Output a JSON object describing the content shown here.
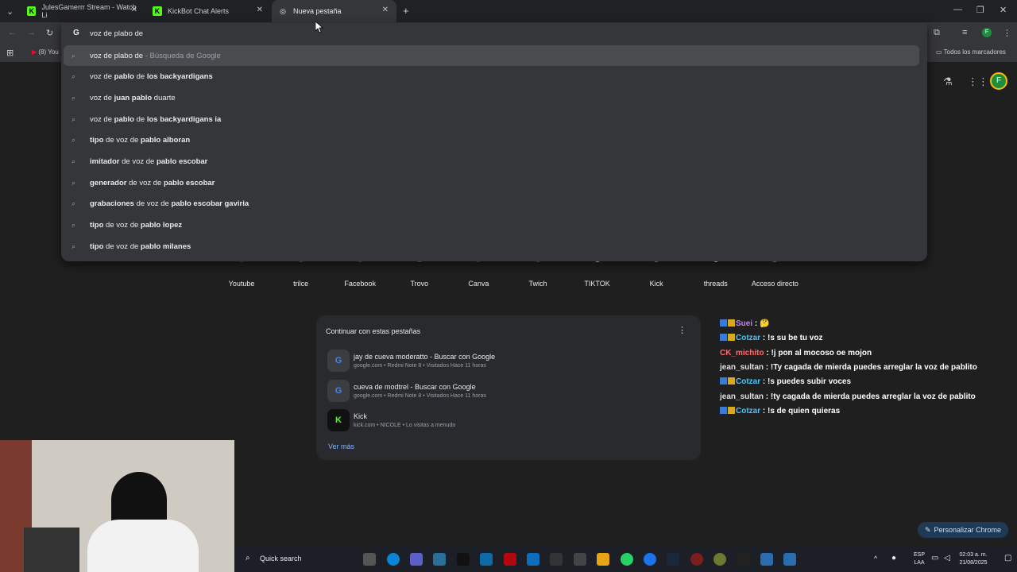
{
  "browser": {
    "tabs": [
      {
        "label": "JulesGamerrr Stream - Watch Li",
        "favicon": "K"
      },
      {
        "label": "KickBot Chat Alerts",
        "favicon": "K"
      },
      {
        "label": "Nueva pestaña",
        "favicon": "◎"
      }
    ],
    "new_tab_symbol": "+",
    "omnibox_value": "voz de plabo de",
    "bookmark_item": "(8) You",
    "all_bookmarks": "Todos los marcadores",
    "profile_letter": "F"
  },
  "suggestions": [
    {
      "icon": "search-icon",
      "parts": [
        {
          "t": "voz de plabo de",
          "b": false
        },
        {
          "t": " - Búsqueda de Google",
          "b": false,
          "desc": true
        }
      ]
    },
    {
      "icon": "search-icon",
      "parts": [
        {
          "t": "voz de ",
          "b": false
        },
        {
          "t": "pablo",
          "b": true
        },
        {
          "t": " de ",
          "b": false
        },
        {
          "t": "los backyardigans",
          "b": true
        }
      ]
    },
    {
      "icon": "search-icon",
      "parts": [
        {
          "t": "voz de ",
          "b": false
        },
        {
          "t": "juan pablo",
          "b": true
        },
        {
          "t": " duarte",
          "b": false
        }
      ]
    },
    {
      "icon": "search-icon",
      "parts": [
        {
          "t": "voz de ",
          "b": false
        },
        {
          "t": "pablo",
          "b": true
        },
        {
          "t": " de ",
          "b": false
        },
        {
          "t": "los backyardigans ia",
          "b": true
        }
      ]
    },
    {
      "icon": "search-icon",
      "parts": [
        {
          "t": "tipo",
          "b": true
        },
        {
          "t": " de voz de ",
          "b": false
        },
        {
          "t": "pablo alboran",
          "b": true
        }
      ]
    },
    {
      "icon": "search-icon",
      "parts": [
        {
          "t": "imitador",
          "b": true
        },
        {
          "t": " de voz de ",
          "b": false
        },
        {
          "t": "pablo escobar",
          "b": true
        }
      ]
    },
    {
      "icon": "search-icon",
      "parts": [
        {
          "t": "generador",
          "b": true
        },
        {
          "t": " de voz de ",
          "b": false
        },
        {
          "t": "pablo escobar",
          "b": true
        }
      ]
    },
    {
      "icon": "search-icon",
      "parts": [
        {
          "t": "grabaciones",
          "b": true
        },
        {
          "t": " de voz de ",
          "b": false
        },
        {
          "t": "pablo escobar gaviria",
          "b": true
        }
      ]
    },
    {
      "icon": "search-icon",
      "parts": [
        {
          "t": "tipo",
          "b": true
        },
        {
          "t": " de voz de ",
          "b": false
        },
        {
          "t": "pablo lopez",
          "b": true
        }
      ]
    },
    {
      "icon": "search-icon",
      "parts": [
        {
          "t": "tipo",
          "b": true
        },
        {
          "t": " de voz de ",
          "b": false
        },
        {
          "t": "pablo milanes",
          "b": true
        }
      ]
    }
  ],
  "shortcuts": [
    {
      "label": "Youtube",
      "color": "#ff0033"
    },
    {
      "label": "trilce",
      "color": "#e53935"
    },
    {
      "label": "Facebook",
      "color": "#1877f2"
    },
    {
      "label": "Trovo",
      "color": "#19d66b"
    },
    {
      "label": "Canva",
      "color": "#7d2ae8"
    },
    {
      "label": "Twich",
      "color": "#9146ff"
    },
    {
      "label": "TIKTOK",
      "color": "#ffffff"
    },
    {
      "label": "Kick",
      "color": "#53fc18"
    },
    {
      "label": "threads",
      "color": "#ffffff"
    },
    {
      "label": "Acceso directo",
      "color": "#8ab4f8"
    }
  ],
  "continue_card": {
    "title": "Continuar con estas pestañas",
    "items": [
      {
        "title": "jay de cueva moderatto - Buscar con Google",
        "meta": "google.com • Redmi Note 8 • Visitados Hace 11 horas",
        "icon": "G"
      },
      {
        "title": "cueva de modtrel - Buscar con Google",
        "meta": "google.com • Redmi Note 8 • Visitados Hace 11 horas",
        "icon": "G"
      },
      {
        "title": "Kick",
        "meta": "kick.com • NICOLE • Lo visitas a menudo",
        "icon": "K"
      }
    ],
    "more": "Ver más"
  },
  "chat": [
    {
      "user": "Suei",
      "color": "#c77dff",
      "badges": true,
      "text": ": 🤔"
    },
    {
      "user": "Cotzar",
      "color": "#4fc3f7",
      "badges": true,
      "text": ": !s su be tu voz"
    },
    {
      "user": "CK_michito",
      "color": "#ff6b6b",
      "badges": false,
      "text": ": !j pon al mocoso oe mojon"
    },
    {
      "user": "jean_sultan",
      "color": "#e0e0e0",
      "badges": false,
      "text": ": !Ty cagada de mierda puedes arreglar la voz de pablito"
    },
    {
      "user": "Cotzar",
      "color": "#4fc3f7",
      "badges": true,
      "text": ": !s puedes subir voces"
    },
    {
      "user": "jean_sultan",
      "color": "#e0e0e0",
      "badges": false,
      "text": ": !ty cagada de mierda puedes arreglar la voz de pablito"
    },
    {
      "user": "Cotzar",
      "color": "#4fc3f7",
      "badges": true,
      "text": ": !s de quien quieras"
    }
  ],
  "personalize": "Personalizar Chrome",
  "taskbar": {
    "search": "Quick search",
    "lang": "ESP",
    "lang2": "LAA",
    "time": "02:03 a. m.",
    "date": "21/08/2025"
  }
}
